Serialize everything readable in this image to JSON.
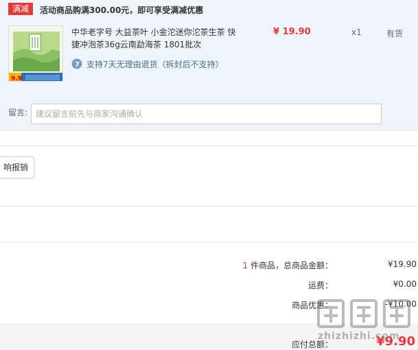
{
  "promo": {
    "tag": "满减",
    "text": "活动商品购满300.00元，即可享受满减优惠"
  },
  "product": {
    "title": "中华老字号 大益茶叶 小金沱迷你沱茶生茶 快捷冲泡茶36g云南勐海茶 1801批次",
    "price": "¥ 19.90",
    "quantity": "x1",
    "stock": "有货",
    "return_policy": "支持7天无理由退货（拆封后不支持）",
    "return_icon_label": "7",
    "thumb_price": "9.9",
    "icon": "product-image"
  },
  "note": {
    "label": "留言:",
    "placeholder": "建议留言前先与商家沟通确认"
  },
  "invoice": {
    "button_label": "响报销"
  },
  "summary": {
    "count": "1",
    "count_suffix": " 件商品，总商品金额：",
    "goods_total": "¥19.90",
    "shipping_label": "运费：",
    "shipping_value": "¥0.00",
    "discount_label": "商品优惠：",
    "discount_value": "-¥10.00",
    "payable_label": "应付总额：",
    "payable_value": "¥9.90"
  },
  "watermark": {
    "text": "zhizhizhi.com"
  },
  "colors": {
    "accent_red": "#e4393c",
    "panel_bg": "#eef4fa",
    "link_blue": "#4a6b8a"
  }
}
